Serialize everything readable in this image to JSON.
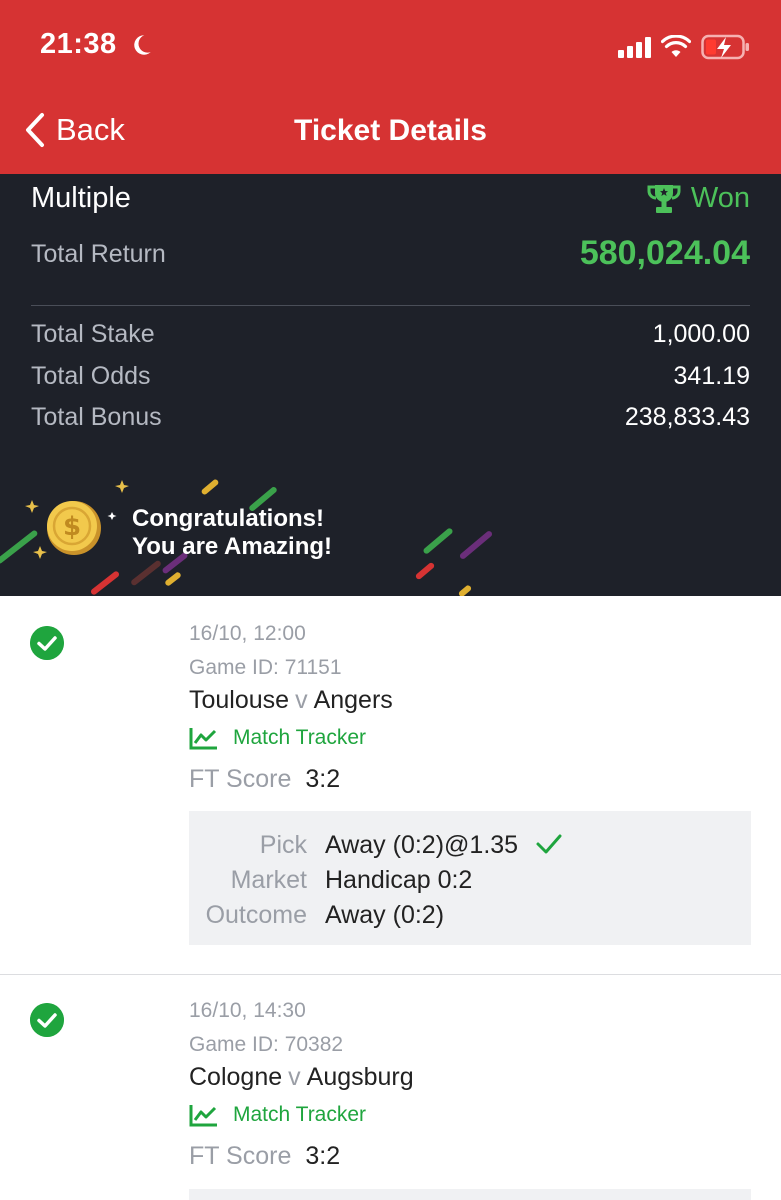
{
  "status_bar": {
    "time": "21:38"
  },
  "header": {
    "back_label": "Back",
    "title": "Ticket Details"
  },
  "summary": {
    "bet_type": "Multiple",
    "status": "Won",
    "total_return_label": "Total Return",
    "total_return": "580,024.04",
    "rows": [
      {
        "label": "Total Stake",
        "value": "1,000.00"
      },
      {
        "label": "Total Odds",
        "value": "341.19"
      },
      {
        "label": "Total Bonus",
        "value": "238,833.43"
      }
    ],
    "banner_line1": "Congratulations!",
    "banner_line2": "You are Amazing!"
  },
  "selections": [
    {
      "datetime": "16/10, 12:00",
      "game_id": "Game ID: 71151",
      "home": "Toulouse",
      "vs": "v",
      "away": "Angers",
      "tracker_label": "Match Tracker",
      "ft_label": "FT Score",
      "ft_score": "3:2",
      "pick_label": "Pick",
      "pick": "Away (0:2)@1.35",
      "market_label": "Market",
      "market": "Handicap 0:2",
      "outcome_label": "Outcome",
      "outcome": "Away (0:2)"
    },
    {
      "datetime": "16/10, 14:30",
      "game_id": "Game ID: 70382",
      "home": "Cologne",
      "vs": "v",
      "away": "Augsburg",
      "tracker_label": "Match Tracker",
      "ft_label": "FT Score",
      "ft_score": "3:2"
    }
  ],
  "colors": {
    "header_red": "#d63333",
    "panel_dark": "#1e2129",
    "win_green": "#4cc15a",
    "check_green": "#1fa53e"
  }
}
